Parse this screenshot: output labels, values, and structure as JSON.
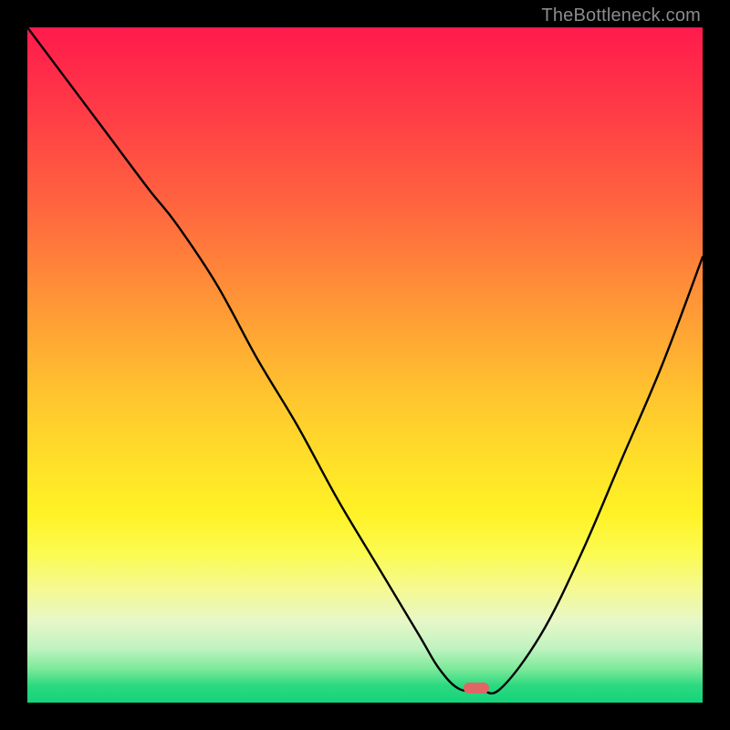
{
  "watermark": "TheBottleneck.com",
  "marker": {
    "x_pct": 66.5,
    "y_pct": 97.8
  },
  "chart_data": {
    "type": "line",
    "title": "",
    "xlabel": "",
    "ylabel": "",
    "xlim": [
      0,
      100
    ],
    "ylim": [
      0,
      100
    ],
    "grid": false,
    "legend": false,
    "annotations": [
      "TheBottleneck.com"
    ],
    "series": [
      {
        "name": "bottleneck-curve",
        "x": [
          0,
          6,
          12,
          18,
          22,
          28,
          34,
          40,
          46,
          52,
          58,
          61,
          64,
          67,
          70,
          76,
          82,
          88,
          94,
          100
        ],
        "values": [
          100,
          92,
          84,
          76,
          71,
          62,
          51,
          41,
          30,
          20,
          10,
          5,
          2,
          2,
          2,
          10,
          22,
          36,
          50,
          66
        ]
      }
    ],
    "gradient_stops": [
      {
        "pct": 0,
        "color": "#ff1a4d"
      },
      {
        "pct": 12,
        "color": "#ff3a46"
      },
      {
        "pct": 28,
        "color": "#ff6a3e"
      },
      {
        "pct": 42,
        "color": "#ff9a36"
      },
      {
        "pct": 55,
        "color": "#ffc62e"
      },
      {
        "pct": 66,
        "color": "#ffe428"
      },
      {
        "pct": 72,
        "color": "#fff226"
      },
      {
        "pct": 78,
        "color": "#fbfb52"
      },
      {
        "pct": 83,
        "color": "#f5f990"
      },
      {
        "pct": 88,
        "color": "#e7f7c8"
      },
      {
        "pct": 92,
        "color": "#bff3bf"
      },
      {
        "pct": 95,
        "color": "#7ce99a"
      },
      {
        "pct": 97.5,
        "color": "#2bd97f"
      },
      {
        "pct": 100,
        "color": "#15d37a"
      }
    ],
    "marker": {
      "x": 66.5,
      "y": 2.2,
      "color": "#e06666",
      "shape": "pill"
    }
  }
}
